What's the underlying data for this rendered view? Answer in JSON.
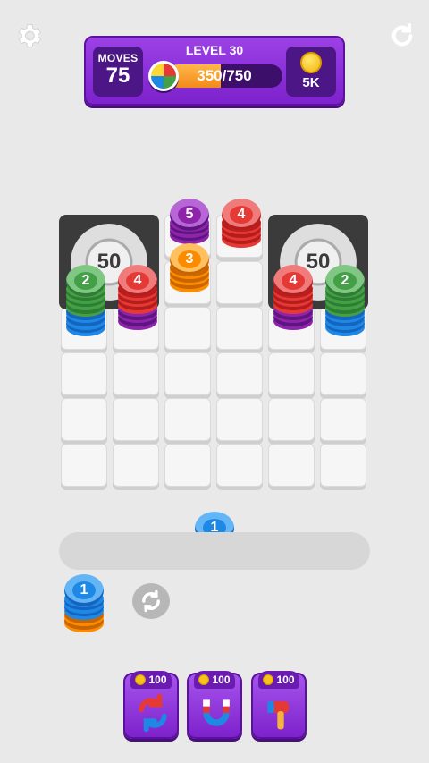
{
  "hud": {
    "moves_label": "MOVES",
    "moves_value": "75",
    "level_label": "LEVEL 30",
    "progress_text": "350/750",
    "progress_fraction": 0.4667,
    "coins_value": "5K"
  },
  "board": {
    "vault_left_value": "50",
    "vault_right_value": "50"
  },
  "stacks": {
    "s5": "5",
    "s4_top": "4",
    "s3": "3",
    "s2_left": "2",
    "s4_left": "4",
    "s4_right": "4",
    "s2_right": "2",
    "tray_stack": "1",
    "next_stack": "1"
  },
  "boosters": [
    {
      "price": "100",
      "icon": "shuffle-icon"
    },
    {
      "price": "100",
      "icon": "magnet-icon"
    },
    {
      "price": "100",
      "icon": "hammer-icon"
    }
  ],
  "colors": {
    "purple": "#7d22cc",
    "chip_blue": "#1e88e5",
    "chip_green": "#43a047",
    "chip_red": "#e53935",
    "chip_purple": "#8e24aa",
    "chip_orange": "#fb8c00"
  }
}
